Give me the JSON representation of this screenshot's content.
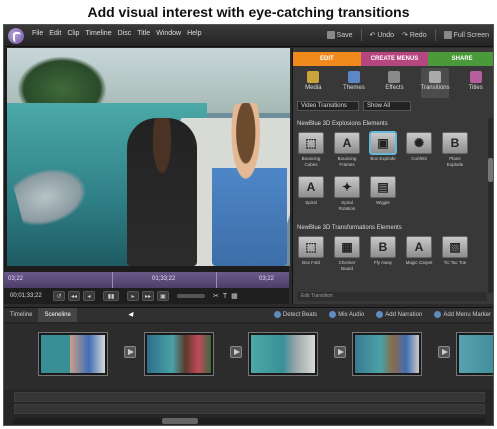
{
  "caption": "Add visual interest with eye-catching transitions",
  "menu": [
    "File",
    "Edit",
    "Clip",
    "Timeline",
    "Disc",
    "Title",
    "Window",
    "Help"
  ],
  "toolbar": {
    "save": "Save",
    "undo": "Undo",
    "redo": "Redo",
    "fullscreen": "Full Screen"
  },
  "monitor": {
    "timecode": "00;01;33;22",
    "time_labels": [
      "03;22",
      "01;33;22",
      "03;22"
    ],
    "buttons": [
      "↺",
      "◂◂",
      "◂",
      "▮▮",
      "▸",
      "▸▸",
      "▣"
    ]
  },
  "panel": {
    "tabs": [
      "EDIT",
      "CREATE MENUS",
      "SHARE"
    ],
    "categories": [
      "Media",
      "Themes",
      "Effects",
      "Transitions",
      "Titles"
    ],
    "filter1": "Video Transitions",
    "filter2": "Show All",
    "group1": "NewBlue 3D Explosions Elements",
    "group1_tiles": [
      {
        "glyph": "⬚",
        "label": "Bouncing Cubes"
      },
      {
        "glyph": "A",
        "label": "Bouncing Frames"
      },
      {
        "glyph": "▣",
        "label": "Box Explode"
      },
      {
        "glyph": "✺",
        "label": "Confetti"
      },
      {
        "glyph": "B",
        "label": "Plane Explode"
      },
      {
        "glyph": "A",
        "label": "Spiral"
      },
      {
        "glyph": "✦",
        "label": "Spiral Rotation"
      },
      {
        "glyph": "▤",
        "label": "Wiggle"
      }
    ],
    "group2": "NewBlue 3D Transformations Elements",
    "group2_tiles": [
      {
        "glyph": "⬚",
        "label": "Box Fold"
      },
      {
        "glyph": "▦",
        "label": "Checker Board"
      },
      {
        "glyph": "B",
        "label": "Fly Away"
      },
      {
        "glyph": "A",
        "label": "Magic Carpet"
      },
      {
        "glyph": "▧",
        "label": "Tic Tac Toe"
      }
    ],
    "edit_transition": "Edit Transition"
  },
  "lower": {
    "tabs": [
      "Timeline",
      "Sceneline"
    ],
    "tools": [
      "Detect Beats",
      "Mix Audio",
      "Add Narration",
      "Add Menu Marker"
    ]
  }
}
